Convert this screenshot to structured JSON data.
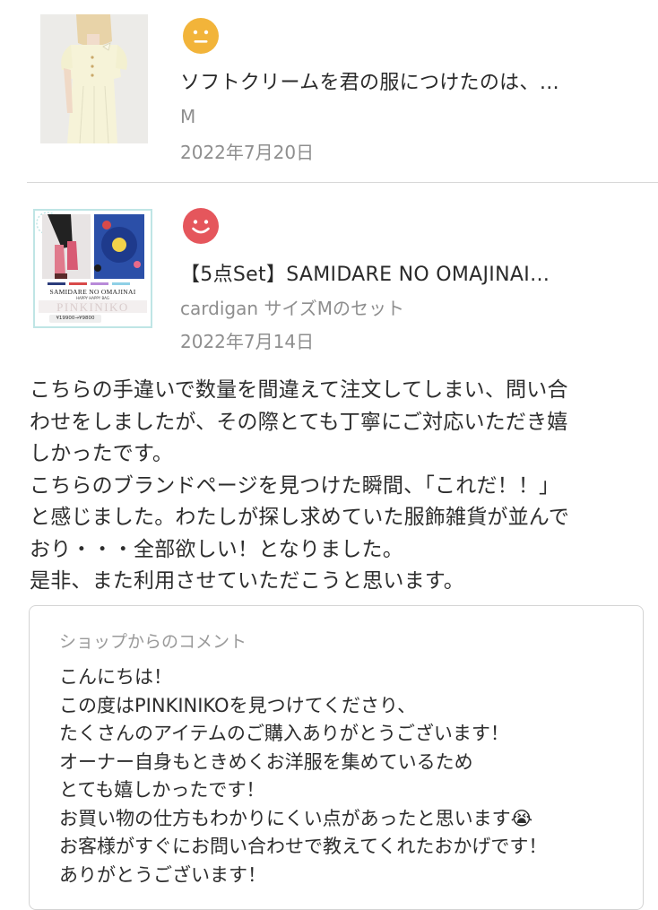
{
  "reviews": [
    {
      "rating_icon": "neutral-face-icon",
      "rating_color": "#f2b43a",
      "title": "ソフトクリームを君の服につけたのは、…",
      "variant": "M",
      "date": "2022年7月20日"
    },
    {
      "rating_icon": "smile-face-icon",
      "rating_color": "#e5565c",
      "title": "【5点Set】SAMIDARE NO OMAJINAI…",
      "variant": "cardigan サイズMのセット",
      "date": "2022年7月14日",
      "thumbnail_text": {
        "line1": "SAMIDARE NO OMAJINAI",
        "line2": "HAPPY HAPPY BAG",
        "brand": "PINKINIKO",
        "price": "¥19900→¥9800"
      },
      "body_lines": [
        "こちらの手違いで数量を間違えて注文してしまい、問い合",
        "わせをしましたが、その際とても丁寧にご対応いただき嬉",
        "しかったです。",
        "こちらのブランドページを見つけた瞬間、「これだ！！」",
        "と感じました。わたしが探し求めていた服飾雑貨が並んで",
        "おり・・・全部欲しい！となりました。",
        "是非、また利用させていただこうと思います。"
      ],
      "shop_comment": {
        "label": "ショップからのコメント",
        "lines": [
          "こんにちは！",
          "この度はPINKINIKOを見つけてくださり、",
          "たくさんのアイテムのご購入ありがとうございます！",
          "オーナー自身もときめくお洋服を集めているため",
          "とても嬉しかったです！",
          "お買い物の仕方もわかりにくい点があったと思います😭",
          "お客様がすぐにお問い合わせで教えてくれたおかげです！",
          "ありがとうございます！"
        ]
      }
    }
  ]
}
